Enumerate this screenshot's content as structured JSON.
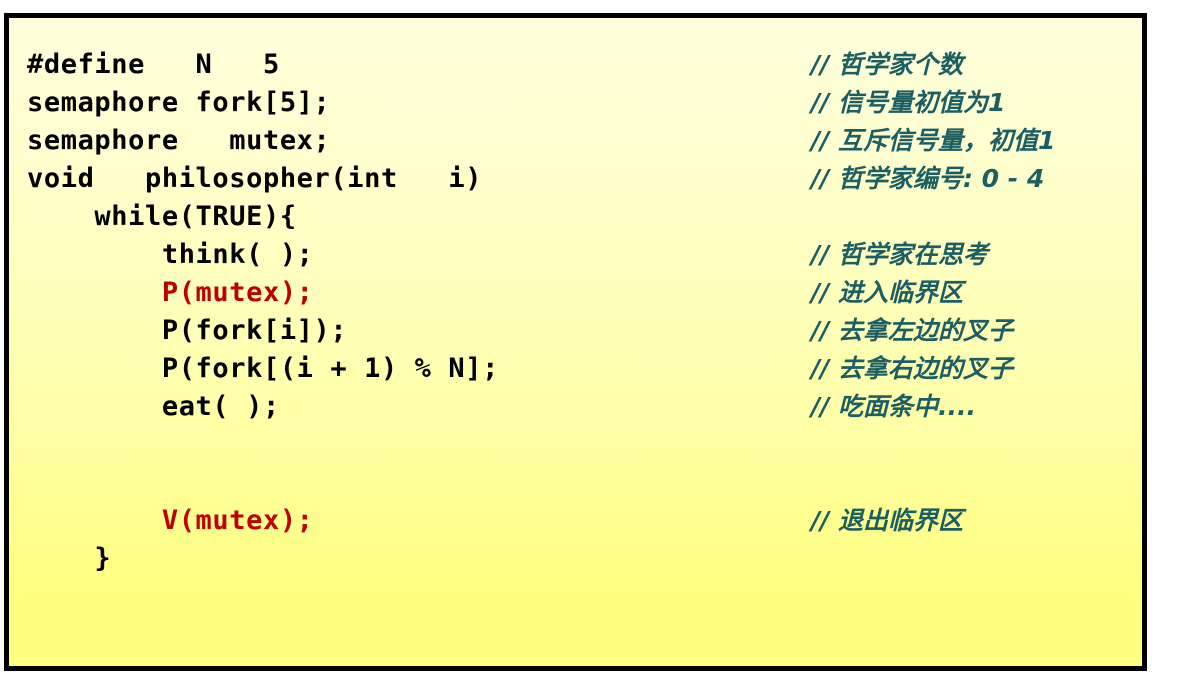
{
  "slide": {
    "name": "dining-philosophers-semaphore-code",
    "colors": {
      "code": "#000000",
      "code_highlight": "#bf0000",
      "comment": "#1b5f63",
      "background_top": "#ffffdc",
      "background_bottom": "#ffff80",
      "border": "#000000"
    }
  },
  "lines": [
    {
      "code": "#define   N   5",
      "code_color": "black",
      "comment": "// 哲学家个数"
    },
    {
      "code": "semaphore fork[5];",
      "code_color": "black",
      "comment": "// 信号量初值为1"
    },
    {
      "code": "semaphore   mutex;",
      "code_color": "black",
      "comment": "// 互斥信号量，初值1"
    },
    {
      "code": "void   philosopher(int   i)",
      "code_color": "black",
      "comment": "// 哲学家编号: 0 - 4"
    },
    {
      "code": "    while(TRUE){",
      "code_color": "black",
      "comment": ""
    },
    {
      "code": "        think( );",
      "code_color": "black",
      "comment": "// 哲学家在思考"
    },
    {
      "code": "        P(mutex);",
      "code_color": "red",
      "comment": "// 进入临界区"
    },
    {
      "code": "        P(fork[i]);",
      "code_color": "black",
      "comment": "// 去拿左边的叉子"
    },
    {
      "code": "        P(fork[(i + 1) % N];",
      "code_color": "black",
      "comment": "// 去拿右边的叉子"
    },
    {
      "code": "        eat( );",
      "code_color": "black",
      "comment": "// 吃面条中...."
    },
    {
      "code": "",
      "code_color": "black",
      "comment": ""
    },
    {
      "code": "",
      "code_color": "black",
      "comment": ""
    },
    {
      "code": "        V(mutex);",
      "code_color": "red",
      "comment": "// 退出临界区"
    },
    {
      "code": "    }",
      "code_color": "black",
      "comment": ""
    }
  ]
}
